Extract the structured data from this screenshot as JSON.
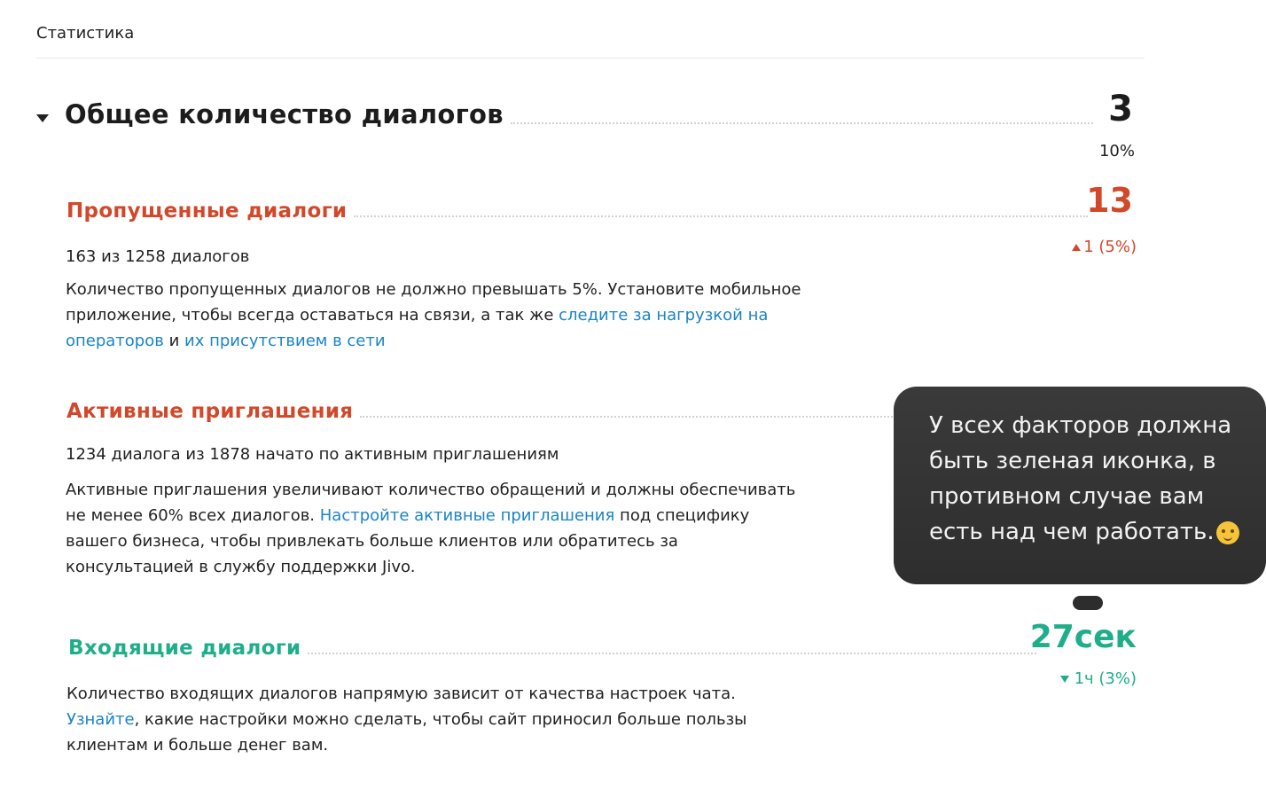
{
  "breadcrumb": "Статистика",
  "colors": {
    "red": "#d2482a",
    "green": "#1fae8a",
    "link": "#1a84c7"
  },
  "total": {
    "title": "Общее количество диалогов",
    "value": "3",
    "change": "10%"
  },
  "missed": {
    "title": "Пропущенные диалоги",
    "value": "13",
    "change": "1 (5%)",
    "change_icon": "triangle-up-icon",
    "summary": "163 из 1258 диалогов",
    "desc_1": "Количество пропущенных диалогов не должно превышать 5%. Установите мобильное приложение, чтобы всегда оставаться на связи, а так же ",
    "link_1": "следите за нагрузкой на операторов",
    "desc_2": " и ",
    "link_2": "их присутствием в сети"
  },
  "invites": {
    "title": "Активные приглашения",
    "summary": "1234 диалога из 1878 начато по активным приглашениям",
    "desc_1": "Активные приглашения увеличивают количество обращений и должны обеспечивать не менее 60% всех диалогов. ",
    "link_1": "Настройте активные приглашения",
    "desc_2": " под специфику вашего бизнеса, чтобы привлекать больше клиентов или обратитесь за консультацией в службу поддержки Jivo."
  },
  "incoming": {
    "title": "Входящие диалоги",
    "value": "27сек",
    "change": "1ч (3%)",
    "change_icon": "triangle-down-icon",
    "link_1": "Узнайте",
    "desc_0": "Количество входящих диалогов напрямую зависит от качества настроек чата. ",
    "desc_1": ", какие настройки можно сделать, чтобы сайт приносил больше пользы клиентам и больше денег вам."
  },
  "tooltip": {
    "text": "У всех факторов должна быть зеленая иконка, в противном случае вам есть над чем работать.",
    "emoji": "upside-down-face-emoji"
  }
}
